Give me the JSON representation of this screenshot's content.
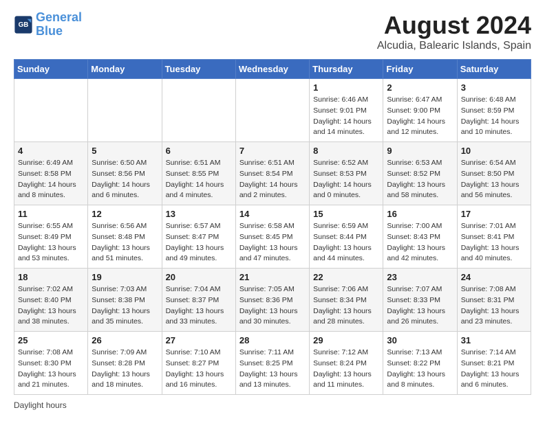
{
  "header": {
    "logo_line1": "General",
    "logo_line2": "Blue",
    "month": "August 2024",
    "location": "Alcudia, Balearic Islands, Spain"
  },
  "weekdays": [
    "Sunday",
    "Monday",
    "Tuesday",
    "Wednesday",
    "Thursday",
    "Friday",
    "Saturday"
  ],
  "weeks": [
    [
      {
        "day": "",
        "info": ""
      },
      {
        "day": "",
        "info": ""
      },
      {
        "day": "",
        "info": ""
      },
      {
        "day": "",
        "info": ""
      },
      {
        "day": "1",
        "info": "Sunrise: 6:46 AM\nSunset: 9:01 PM\nDaylight: 14 hours and 14 minutes."
      },
      {
        "day": "2",
        "info": "Sunrise: 6:47 AM\nSunset: 9:00 PM\nDaylight: 14 hours and 12 minutes."
      },
      {
        "day": "3",
        "info": "Sunrise: 6:48 AM\nSunset: 8:59 PM\nDaylight: 14 hours and 10 minutes."
      }
    ],
    [
      {
        "day": "4",
        "info": "Sunrise: 6:49 AM\nSunset: 8:58 PM\nDaylight: 14 hours and 8 minutes."
      },
      {
        "day": "5",
        "info": "Sunrise: 6:50 AM\nSunset: 8:56 PM\nDaylight: 14 hours and 6 minutes."
      },
      {
        "day": "6",
        "info": "Sunrise: 6:51 AM\nSunset: 8:55 PM\nDaylight: 14 hours and 4 minutes."
      },
      {
        "day": "7",
        "info": "Sunrise: 6:51 AM\nSunset: 8:54 PM\nDaylight: 14 hours and 2 minutes."
      },
      {
        "day": "8",
        "info": "Sunrise: 6:52 AM\nSunset: 8:53 PM\nDaylight: 14 hours and 0 minutes."
      },
      {
        "day": "9",
        "info": "Sunrise: 6:53 AM\nSunset: 8:52 PM\nDaylight: 13 hours and 58 minutes."
      },
      {
        "day": "10",
        "info": "Sunrise: 6:54 AM\nSunset: 8:50 PM\nDaylight: 13 hours and 56 minutes."
      }
    ],
    [
      {
        "day": "11",
        "info": "Sunrise: 6:55 AM\nSunset: 8:49 PM\nDaylight: 13 hours and 53 minutes."
      },
      {
        "day": "12",
        "info": "Sunrise: 6:56 AM\nSunset: 8:48 PM\nDaylight: 13 hours and 51 minutes."
      },
      {
        "day": "13",
        "info": "Sunrise: 6:57 AM\nSunset: 8:47 PM\nDaylight: 13 hours and 49 minutes."
      },
      {
        "day": "14",
        "info": "Sunrise: 6:58 AM\nSunset: 8:45 PM\nDaylight: 13 hours and 47 minutes."
      },
      {
        "day": "15",
        "info": "Sunrise: 6:59 AM\nSunset: 8:44 PM\nDaylight: 13 hours and 44 minutes."
      },
      {
        "day": "16",
        "info": "Sunrise: 7:00 AM\nSunset: 8:43 PM\nDaylight: 13 hours and 42 minutes."
      },
      {
        "day": "17",
        "info": "Sunrise: 7:01 AM\nSunset: 8:41 PM\nDaylight: 13 hours and 40 minutes."
      }
    ],
    [
      {
        "day": "18",
        "info": "Sunrise: 7:02 AM\nSunset: 8:40 PM\nDaylight: 13 hours and 38 minutes."
      },
      {
        "day": "19",
        "info": "Sunrise: 7:03 AM\nSunset: 8:38 PM\nDaylight: 13 hours and 35 minutes."
      },
      {
        "day": "20",
        "info": "Sunrise: 7:04 AM\nSunset: 8:37 PM\nDaylight: 13 hours and 33 minutes."
      },
      {
        "day": "21",
        "info": "Sunrise: 7:05 AM\nSunset: 8:36 PM\nDaylight: 13 hours and 30 minutes."
      },
      {
        "day": "22",
        "info": "Sunrise: 7:06 AM\nSunset: 8:34 PM\nDaylight: 13 hours and 28 minutes."
      },
      {
        "day": "23",
        "info": "Sunrise: 7:07 AM\nSunset: 8:33 PM\nDaylight: 13 hours and 26 minutes."
      },
      {
        "day": "24",
        "info": "Sunrise: 7:08 AM\nSunset: 8:31 PM\nDaylight: 13 hours and 23 minutes."
      }
    ],
    [
      {
        "day": "25",
        "info": "Sunrise: 7:08 AM\nSunset: 8:30 PM\nDaylight: 13 hours and 21 minutes."
      },
      {
        "day": "26",
        "info": "Sunrise: 7:09 AM\nSunset: 8:28 PM\nDaylight: 13 hours and 18 minutes."
      },
      {
        "day": "27",
        "info": "Sunrise: 7:10 AM\nSunset: 8:27 PM\nDaylight: 13 hours and 16 minutes."
      },
      {
        "day": "28",
        "info": "Sunrise: 7:11 AM\nSunset: 8:25 PM\nDaylight: 13 hours and 13 minutes."
      },
      {
        "day": "29",
        "info": "Sunrise: 7:12 AM\nSunset: 8:24 PM\nDaylight: 13 hours and 11 minutes."
      },
      {
        "day": "30",
        "info": "Sunrise: 7:13 AM\nSunset: 8:22 PM\nDaylight: 13 hours and 8 minutes."
      },
      {
        "day": "31",
        "info": "Sunrise: 7:14 AM\nSunset: 8:21 PM\nDaylight: 13 hours and 6 minutes."
      }
    ]
  ],
  "footer": "Daylight hours"
}
